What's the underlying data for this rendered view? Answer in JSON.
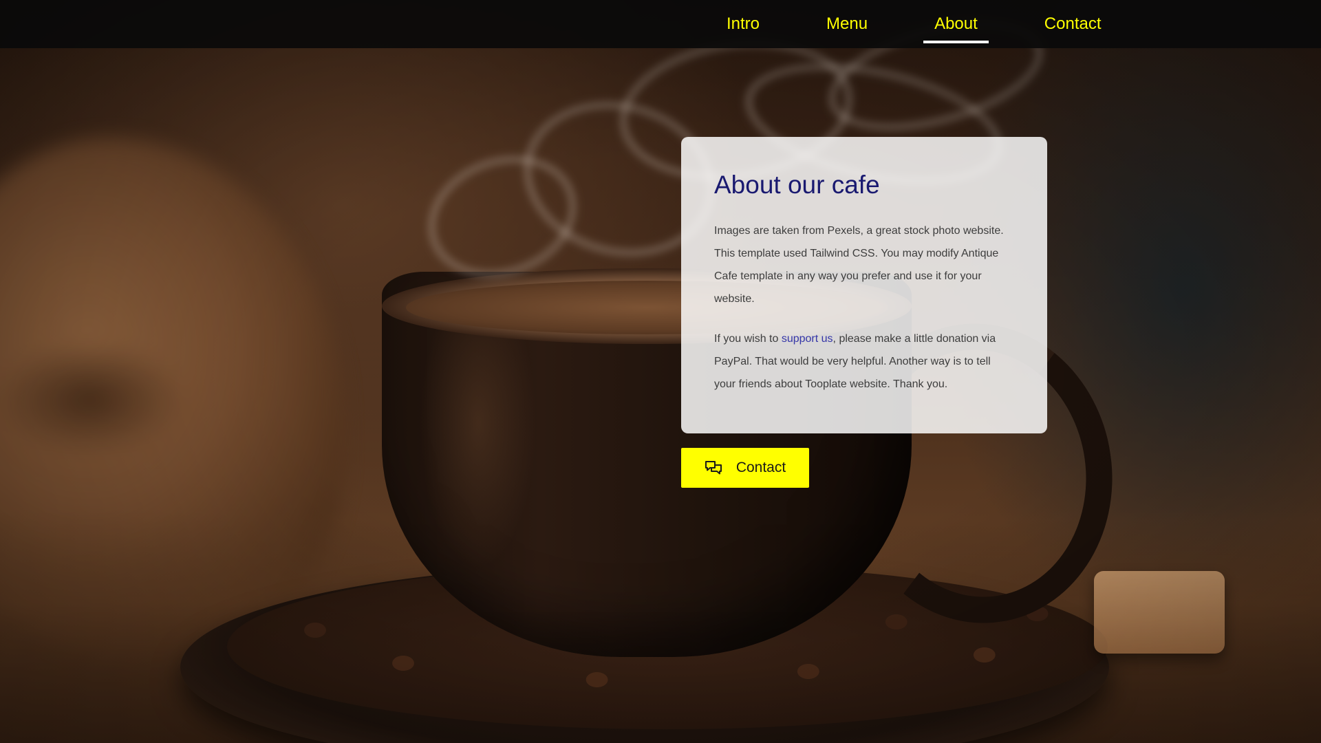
{
  "nav": {
    "items": [
      {
        "label": "Intro",
        "active": false
      },
      {
        "label": "Menu",
        "active": false
      },
      {
        "label": "About",
        "active": true
      },
      {
        "label": "Contact",
        "active": false
      }
    ]
  },
  "about": {
    "title": "About our cafe",
    "paragraph1": "Images are taken from Pexels, a great stock photo website. This template used Tailwind CSS. You may modify Antique Cafe template in any way you prefer and use it for your website.",
    "paragraph2_before": "If you wish to ",
    "paragraph2_link": "support us",
    "paragraph2_after": ", please make a little donation via PayPal. That would be very helpful. Another way is to tell your friends about Tooplate website. Thank you."
  },
  "contact_button": {
    "label": "Contact",
    "icon": "chat-bubbles-icon"
  },
  "colors": {
    "accent": "#ffff00",
    "title": "#191970",
    "link": "#3636a8",
    "navbar": "#0a0a0a"
  }
}
